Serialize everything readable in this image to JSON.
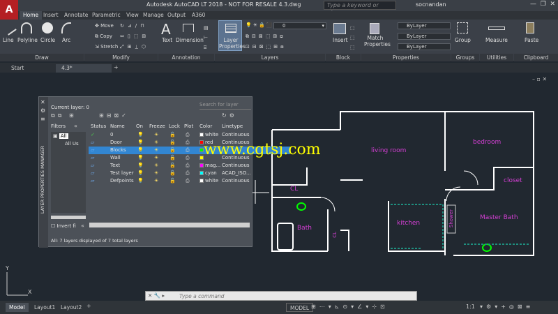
{
  "app": {
    "title": "Autodesk AutoCAD LT 2018 - NOT FOR RESALE    4.3.dwg",
    "logo": "A",
    "search_placeholder": "Type a keyword or phrase",
    "user": "socnandan"
  },
  "ribbon_tabs": [
    "Home",
    "Insert",
    "Annotate",
    "Parametric",
    "View",
    "Manage",
    "Output",
    "A360"
  ],
  "draw_tools": [
    "Line",
    "Polyline",
    "Circle",
    "Arc"
  ],
  "modify": [
    "Move",
    "Copy",
    "Stretch"
  ],
  "annotation": [
    "Text",
    "Dimension"
  ],
  "layer_btn": "Layer Properties",
  "layer_combo": "0",
  "block_btn": "Insert",
  "props_btn": "Match Properties",
  "bylayer": [
    "ByLayer",
    "ByLayer",
    "ByLayer"
  ],
  "groups_btn": "Group",
  "util_btn": "Measure",
  "clip_btn": "Paste",
  "group_labels": [
    "Draw",
    "Modify",
    "Annotation",
    "Layers",
    "Block",
    "Properties",
    "Groups",
    "Utilities",
    "Clipboard"
  ],
  "doc_tabs": [
    "Start",
    "4.3*"
  ],
  "lpm": {
    "current": "Current layer: 0",
    "search": "Search for layer",
    "filters_label": "Filters",
    "tree": [
      "All",
      "All Us"
    ],
    "invert": "Invert fi",
    "vertical_title": "LAYER PROPERTIES MANAGER",
    "status_text": "All: 7 layers displayed of 7 total layers",
    "columns": [
      "Status",
      "Name",
      "On",
      "Freeze",
      "Lock",
      "Plot",
      "Color",
      "Linetype"
    ],
    "layers": [
      {
        "name": "0",
        "color": "white",
        "hex": "#ffffff",
        "linetype": "Continuous"
      },
      {
        "name": "Door",
        "color": "red",
        "hex": "#ff0000",
        "linetype": "Continuous"
      },
      {
        "name": "Blocks",
        "color": "",
        "hex": "#00ff00",
        "linetype": ""
      },
      {
        "name": "Wall",
        "color": "",
        "hex": "#ffff00",
        "linetype": "Continuous"
      },
      {
        "name": "Text",
        "color": "mag...",
        "hex": "#ff00ff",
        "linetype": "Continuous"
      },
      {
        "name": "Test layer",
        "color": "cyan",
        "hex": "#00ffff",
        "linetype": "ACAD_ISO..."
      },
      {
        "name": "Defpoints",
        "color": "white",
        "hex": "#ffffff",
        "linetype": "Continuous"
      }
    ]
  },
  "rooms": [
    "living room",
    "bedroom",
    "closet",
    "CL",
    "Bath",
    "kitchen",
    "Master Bath",
    "Shower",
    "CL"
  ],
  "watermark": "www.cgtsj.com",
  "axis": {
    "y": "Y",
    "x": "X"
  },
  "command_placeholder": "Type a command",
  "layout_tabs": [
    "Model",
    "Layout1",
    "Layout2"
  ],
  "model_label": "MODEL",
  "scale": "1:1"
}
